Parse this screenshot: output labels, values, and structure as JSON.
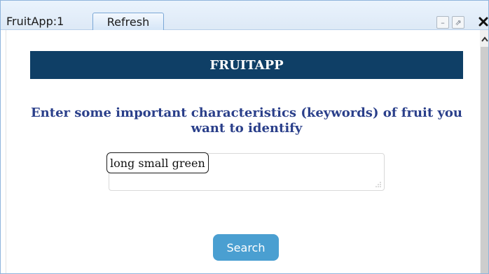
{
  "window": {
    "title": "FruitApp:1",
    "refresh_label": "Refresh",
    "minimize_symbol": "–",
    "popout_symbol": "⇗",
    "close_symbol": "✖"
  },
  "app": {
    "header": "FRUITAPP",
    "prompt": "Enter some important characteristics (keywords) of fruit you want to identify",
    "keywords_value": "long small green",
    "search_label": "Search"
  },
  "colors": {
    "header_bg": "#0f3f66",
    "prompt_text": "#2a3f8a",
    "search_button": "#4a9fd1"
  },
  "icons": {
    "minimize": "minimize-icon",
    "popout": "popout-icon",
    "close": "close-icon",
    "scroll_up": "scroll-up-arrow-icon",
    "resize": "resize-grip-icon"
  }
}
